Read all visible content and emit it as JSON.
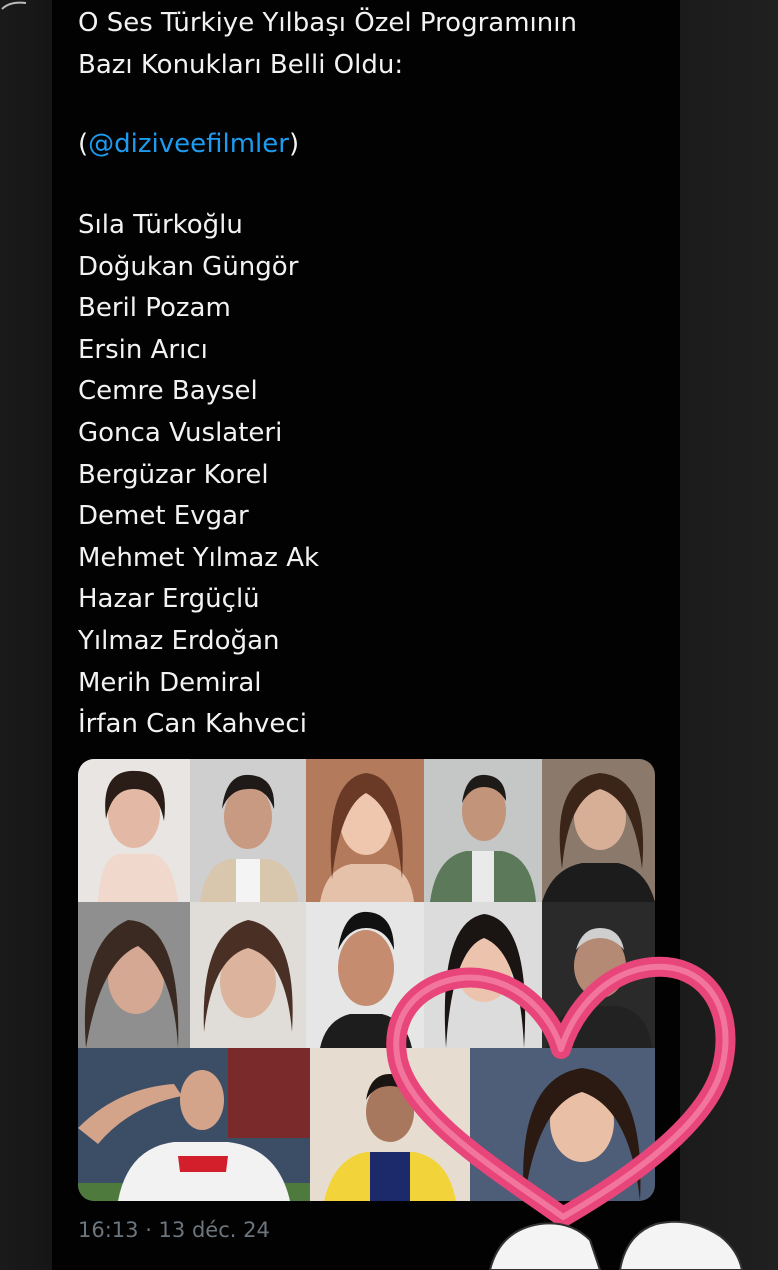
{
  "tweet": {
    "intro_lines": [
      "O Ses Türkiye Yılbaşı Özel Programının",
      "Bazı Konukları Belli Oldu:"
    ],
    "mention_open": "(",
    "mention": "@diziveefilmler",
    "mention_close": ")",
    "names": [
      "Sıla Türkoğlu",
      "Doğukan Güngör",
      "Beril Pozam",
      "Ersin Arıcı",
      "Cemre Baysel",
      "Gonca Vuslateri",
      "Bergüzar Korel",
      "Demet Evgar",
      "Mehmet Yılmaz Ak",
      "Hazar Ergüçlü",
      "Yılmaz Erdoğan",
      "Merih Demiral",
      "İrfan Can Kahveci"
    ],
    "timestamp": "16:13 · 13 déc. 24"
  },
  "colors": {
    "background": "#020202",
    "text": "#f2f2f2",
    "mention": "#1d9bf0",
    "timestamp": "#6e767d",
    "heart": "#e8457a"
  },
  "stickers": {
    "heart": "heart-icon",
    "hands": "hands-icon"
  }
}
